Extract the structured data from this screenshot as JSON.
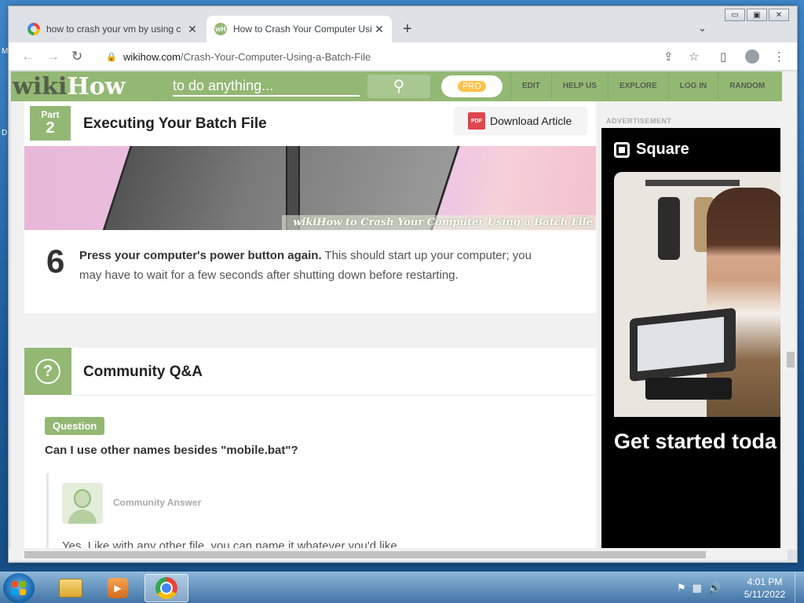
{
  "desktop": {
    "edge_letters": [
      "M",
      "D"
    ]
  },
  "browser": {
    "tabs": [
      {
        "title": "how to crash your vm by using c",
        "favicon": "google-g-icon",
        "active": false
      },
      {
        "title": "How to Crash Your Computer Usi",
        "favicon": "wikihow-icon",
        "active": true
      }
    ],
    "new_tab_glyph": "+",
    "tab_search_glyph": "⌄",
    "close_glyph": "✕",
    "window_controls": {
      "minimize": "▭",
      "maximize": "▣",
      "close": "✕"
    },
    "nav": {
      "back": "←",
      "forward": "→",
      "reload": "↻"
    },
    "address": {
      "host": "wikihow.com",
      "path": "/Crash-Your-Computer-Using-a-Batch-File",
      "lock": "🔒"
    },
    "toolbar_icons": {
      "share": "⇪",
      "bookmark": "☆",
      "sidepanel": "▯",
      "menu": "⋮"
    }
  },
  "wikihow": {
    "logo_wiki": "wiki",
    "logo_how": "How",
    "search_placeholder": "to do anything...",
    "search_icon": "⚲",
    "pro_label": "PRO",
    "nav": [
      "EDIT",
      "HELP US",
      "EXPLORE",
      "LOG IN",
      "RANDOM"
    ],
    "part": {
      "label": "Part",
      "number": "2",
      "title": "Executing Your Batch File",
      "download_label": "Download Article",
      "pdf_glyph": "PDF"
    },
    "image_caption": "wikiHow to Crash Your Computer Using a Batch File",
    "step": {
      "number": "6",
      "bold": "Press your computer's power button again.",
      "text": " This should start up your computer; you may have to wait for a few seconds after shutting down before restarting."
    },
    "qa": {
      "icon_glyph": "?",
      "title": "Community Q&A",
      "question_badge": "Question",
      "question": "Can I use other names besides \"mobile.bat\"?",
      "answer_label": "Community Answer",
      "answer": "Yes. Like with any other file, you can name it whatever you'd like."
    }
  },
  "ad": {
    "label": "ADVERTISEMENT",
    "brand": "Square",
    "headline": "Get started toda"
  },
  "taskbar": {
    "time": "4:01 PM",
    "date": "5/11/2022",
    "tray_icons": [
      "flag-icon",
      "network-icon",
      "volume-icon"
    ],
    "tray_glyphs": [
      "⚑",
      "▦",
      "🔊"
    ]
  },
  "colors": {
    "wikihow_green": "#93b874",
    "wikihow_dark": "#545f4b",
    "pro_yellow": "#ffc24a"
  }
}
